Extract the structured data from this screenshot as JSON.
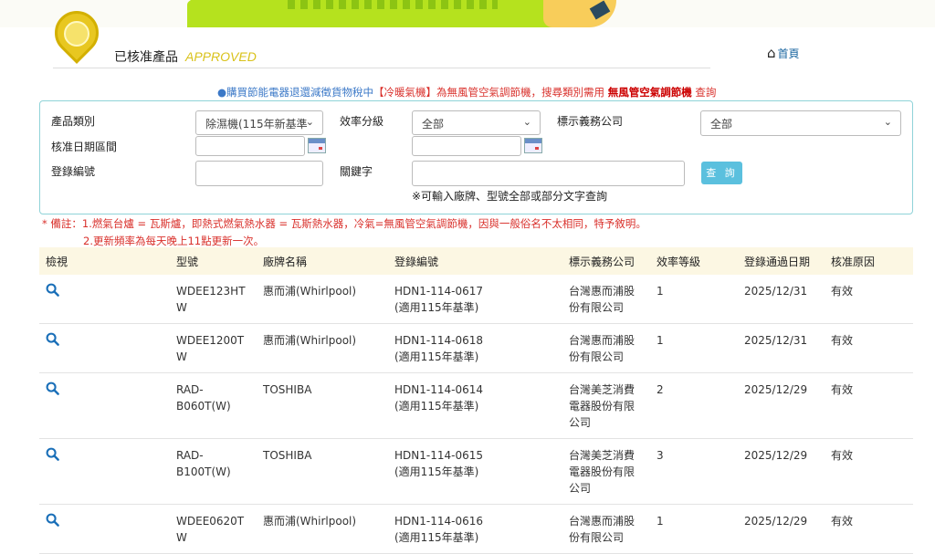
{
  "header": {
    "title": "已核准產品",
    "title_en": "APPROVED",
    "home": "首頁"
  },
  "notice": {
    "part1": "●購買節能電器退還減徵貨物稅中",
    "part2": "【冷暖氣機】為無風管空氣調節機，搜尋類別需用 ",
    "part3": "無風管空氣調節機",
    "part4": " 查詢"
  },
  "form": {
    "category_label": "產品類別",
    "category_value": "除濕機(115年新基準",
    "efficiency_label": "效率分級",
    "efficiency_value": "全部",
    "company_label": "標示義務公司",
    "company_value": "全部",
    "date_label": "核准日期區間",
    "date_from": "",
    "date_to": "",
    "reg_label": "登錄編號",
    "reg_value": "",
    "keyword_label": "關鍵字",
    "keyword_value": "",
    "search_button": "查 詢",
    "hint": "※可輸入廠牌、型號全部或部分文字查詢"
  },
  "remarks": [
    "* 備註：1.燃氣台爐 = 瓦斯爐，即熱式燃氣熱水器 = 瓦斯熱水器，冷氣=無風管空氣調節機，因與一般俗名不太相同，特予敘明。",
    "2.更新頻率為每天晚上11點更新一次。"
  ],
  "table": {
    "headers": [
      "檢視",
      "型號",
      "廠牌名稱",
      "登錄編號",
      "標示義務公司",
      "效率等級",
      "登錄通過日期",
      "核准原因"
    ],
    "rows": [
      {
        "model": "WDEE123HTW",
        "brand": "惠而浦(Whirlpool)",
        "reg": "HDN1-114-0617",
        "reg_note": "(適用115年基準)",
        "company": "台灣惠而浦股份有限公司",
        "grade": "1",
        "date": "2025/12/31",
        "reason": "有效"
      },
      {
        "model": "WDEE1200TW",
        "brand": "惠而浦(Whirlpool)",
        "reg": "HDN1-114-0618",
        "reg_note": "(適用115年基準)",
        "company": "台灣惠而浦股份有限公司",
        "grade": "1",
        "date": "2025/12/31",
        "reason": "有效"
      },
      {
        "model": "RAD-B060T(W)",
        "brand": "TOSHIBA",
        "reg": "HDN1-114-0614",
        "reg_note": "(適用115年基準)",
        "company": "台灣美芝消費電器股份有限公司",
        "grade": "2",
        "date": "2025/12/29",
        "reason": "有效"
      },
      {
        "model": "RAD-B100T(W)",
        "brand": "TOSHIBA",
        "reg": "HDN1-114-0615",
        "reg_note": "(適用115年基準)",
        "company": "台灣美芝消費電器股份有限公司",
        "grade": "3",
        "date": "2025/12/29",
        "reason": "有效"
      },
      {
        "model": "WDEE0620TW",
        "brand": "惠而浦(Whirlpool)",
        "reg": "HDN1-114-0616",
        "reg_note": "(適用115年基準)",
        "company": "台灣惠而浦股份有限公司",
        "grade": "1",
        "date": "2025/12/29",
        "reason": "有效"
      }
    ]
  }
}
